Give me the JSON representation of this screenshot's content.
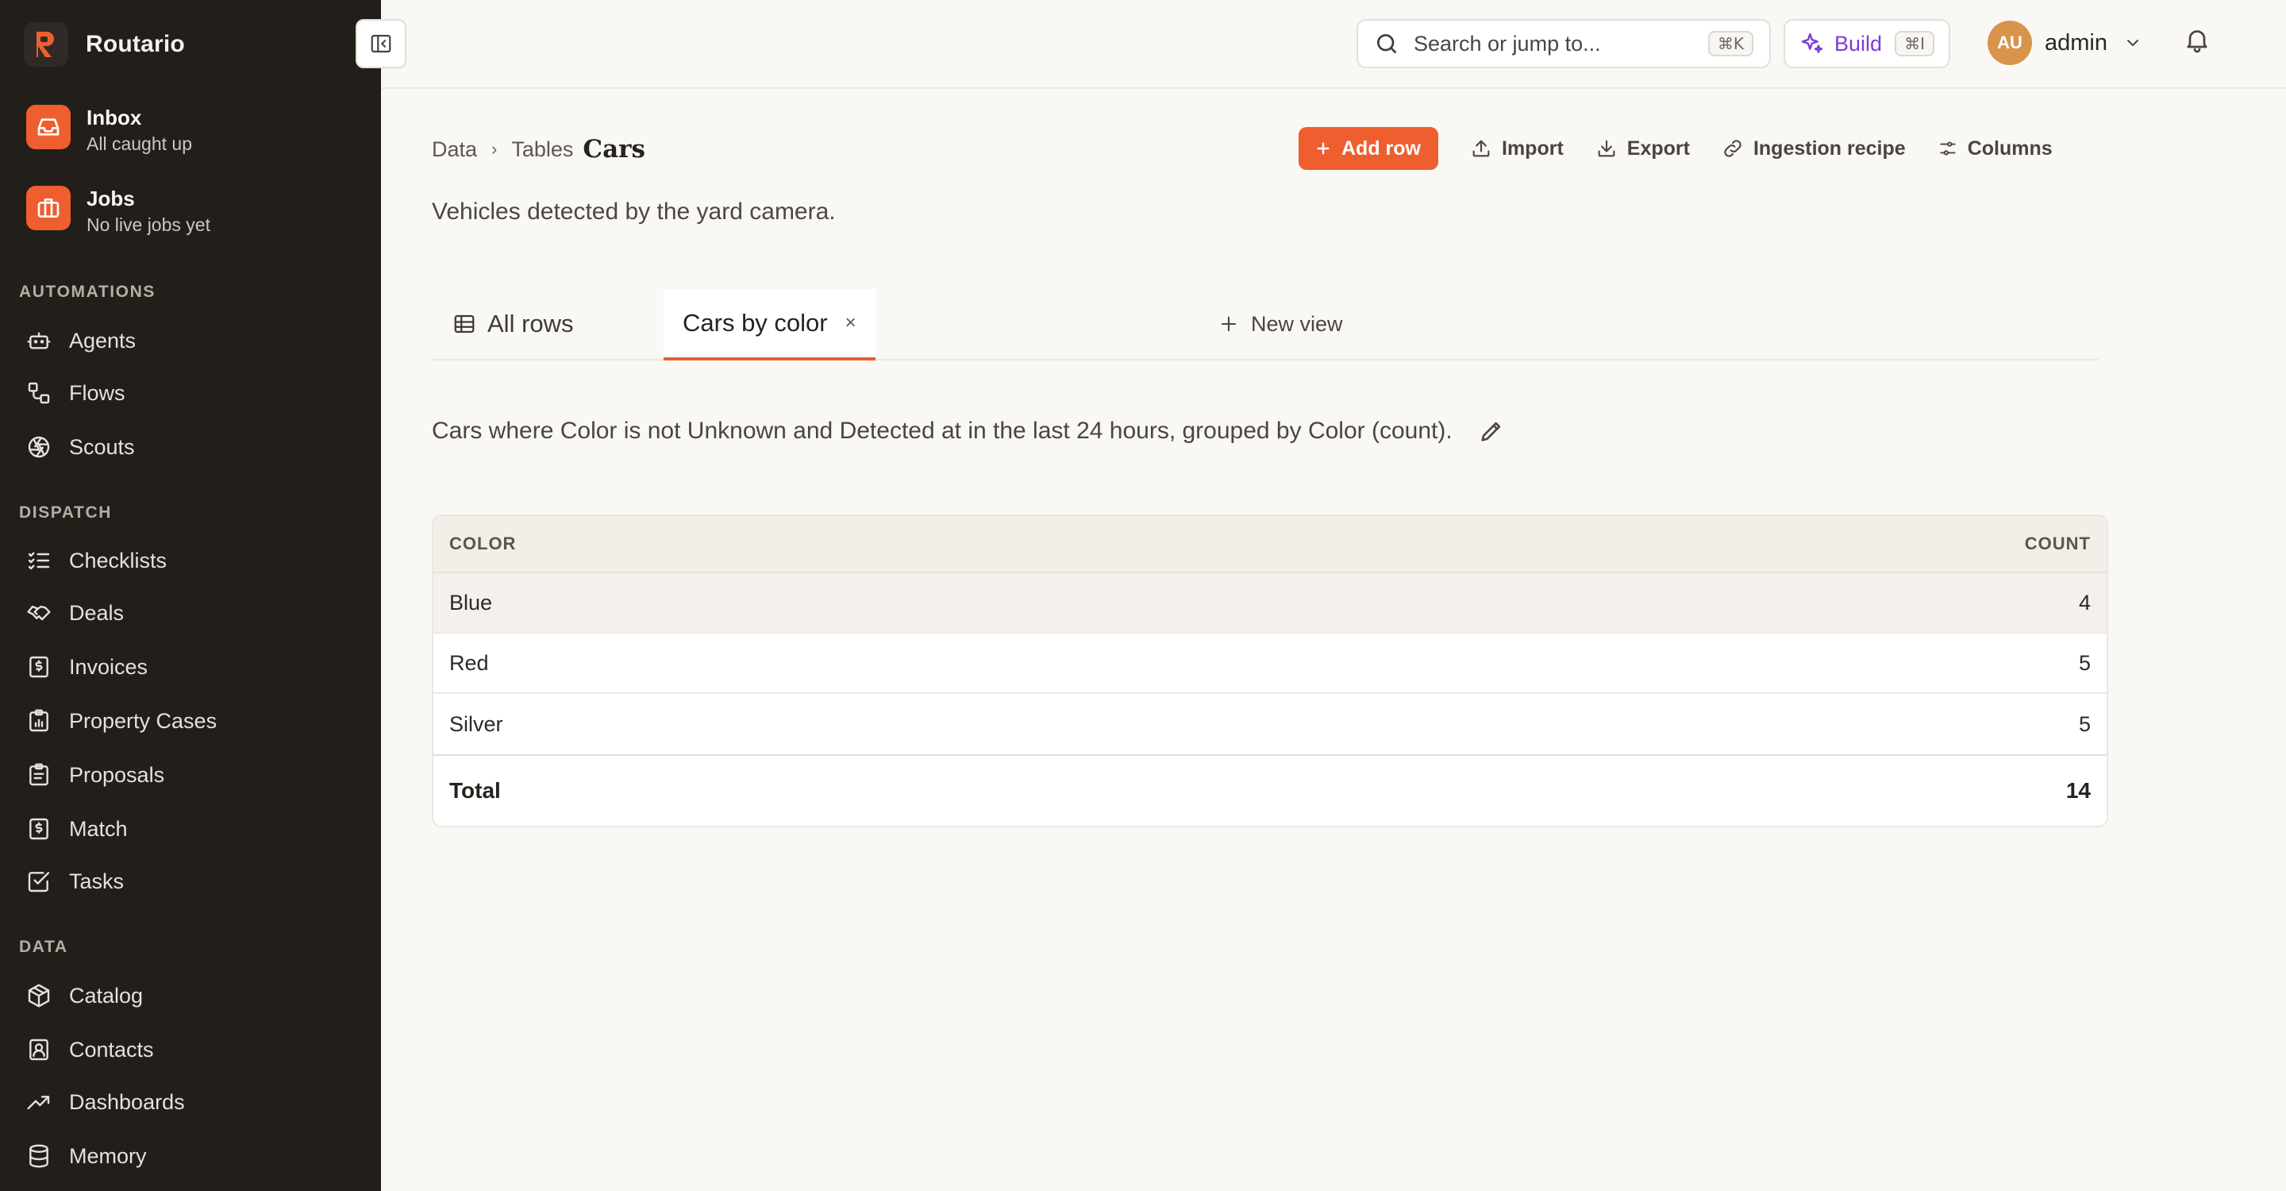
{
  "app": {
    "name": "Routario"
  },
  "sidebar": {
    "pinned": [
      {
        "title": "Inbox",
        "subtitle": "All caught up",
        "icon": "inbox-icon"
      },
      {
        "title": "Jobs",
        "subtitle": "No live jobs yet",
        "icon": "briefcase-icon"
      }
    ],
    "sections": [
      {
        "label": "AUTOMATIONS",
        "items": [
          {
            "label": "Agents",
            "icon": "bot-icon"
          },
          {
            "label": "Flows",
            "icon": "flow-icon"
          },
          {
            "label": "Scouts",
            "icon": "aperture-icon"
          }
        ]
      },
      {
        "label": "DISPATCH",
        "items": [
          {
            "label": "Checklists",
            "icon": "checklist-icon"
          },
          {
            "label": "Deals",
            "icon": "handshake-icon"
          },
          {
            "label": "Invoices",
            "icon": "invoice-icon"
          },
          {
            "label": "Property Cases",
            "icon": "clipboard-chart-icon"
          },
          {
            "label": "Proposals",
            "icon": "clipboard-icon"
          },
          {
            "label": "Match",
            "icon": "receipt-icon"
          },
          {
            "label": "Tasks",
            "icon": "checkbox-icon"
          }
        ]
      },
      {
        "label": "DATA",
        "items": [
          {
            "label": "Catalog",
            "icon": "box-icon"
          },
          {
            "label": "Contacts",
            "icon": "contact-icon"
          },
          {
            "label": "Dashboards",
            "icon": "trend-icon"
          },
          {
            "label": "Memory",
            "icon": "database-icon"
          }
        ]
      }
    ]
  },
  "topbar": {
    "search_placeholder": "Search or jump to...",
    "search_shortcut": "⌘K",
    "build_label": "Build",
    "build_shortcut": "⌘I",
    "user_initials": "AU",
    "user_name": "admin"
  },
  "breadcrumb": {
    "root": "Data",
    "parent": "Tables",
    "current": "Cars"
  },
  "actions": {
    "add_row": "Add row",
    "import": "Import",
    "export": "Export",
    "ingestion": "Ingestion recipe",
    "columns": "Columns"
  },
  "description": "Vehicles detected by the yard camera.",
  "tabs": {
    "all_rows": "All rows",
    "active": "Cars by color",
    "close": "×",
    "new_view": "New view"
  },
  "view_description": "Cars where Color is not Unknown and Detected at in the last 24 hours, grouped by Color (count).",
  "table": {
    "headers": {
      "color": "COLOR",
      "count": "COUNT"
    },
    "rows": [
      {
        "color": "Blue",
        "count": "4"
      },
      {
        "color": "Red",
        "count": "5"
      },
      {
        "color": "Silver",
        "count": "5"
      }
    ],
    "total_label": "Total",
    "total_value": "14"
  },
  "colors": {
    "accent": "#ee5e2f",
    "sidebar_bg": "#221e1a",
    "build": "#7d3ad6"
  }
}
